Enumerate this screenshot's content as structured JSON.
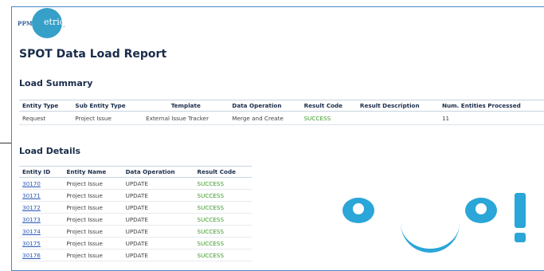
{
  "logo": {
    "prefix": "PPM",
    "wordmark": "etrics",
    "suffix": "."
  },
  "report_title": "SPOT Data Load Report",
  "summary": {
    "heading": "Load Summary",
    "columns": [
      "Entity Type",
      "Sub Entity Type",
      "Template",
      "Data Operation",
      "Result Code",
      "Result Description",
      "Num. Entities Processed"
    ],
    "rows": [
      [
        "Request",
        "Project Issue",
        "External Issue Tracker",
        "Merge and Create",
        "SUCCESS",
        "",
        "11"
      ]
    ]
  },
  "details": {
    "heading": "Load Details",
    "columns": [
      "Entity ID",
      "Entity Name",
      "Data Operation",
      "Result Code"
    ],
    "rows": [
      [
        "30170",
        "Project Issue",
        "UPDATE",
        "SUCCESS"
      ],
      [
        "30171",
        "Project Issue",
        "UPDATE",
        "SUCCESS"
      ],
      [
        "30172",
        "Project Issue",
        "UPDATE",
        "SUCCESS"
      ],
      [
        "30173",
        "Project Issue",
        "UPDATE",
        "SUCCESS"
      ],
      [
        "30174",
        "Project Issue",
        "UPDATE",
        "SUCCESS"
      ],
      [
        "30175",
        "Project Issue",
        "UPDATE",
        "SUCCESS"
      ],
      [
        "30176",
        "Project Issue",
        "UPDATE",
        "SUCCESS"
      ]
    ]
  },
  "colors": {
    "accent": "#2aa6d8",
    "link": "#2b59b8",
    "success": "#3e9a2a",
    "border": "#4a86c5"
  }
}
